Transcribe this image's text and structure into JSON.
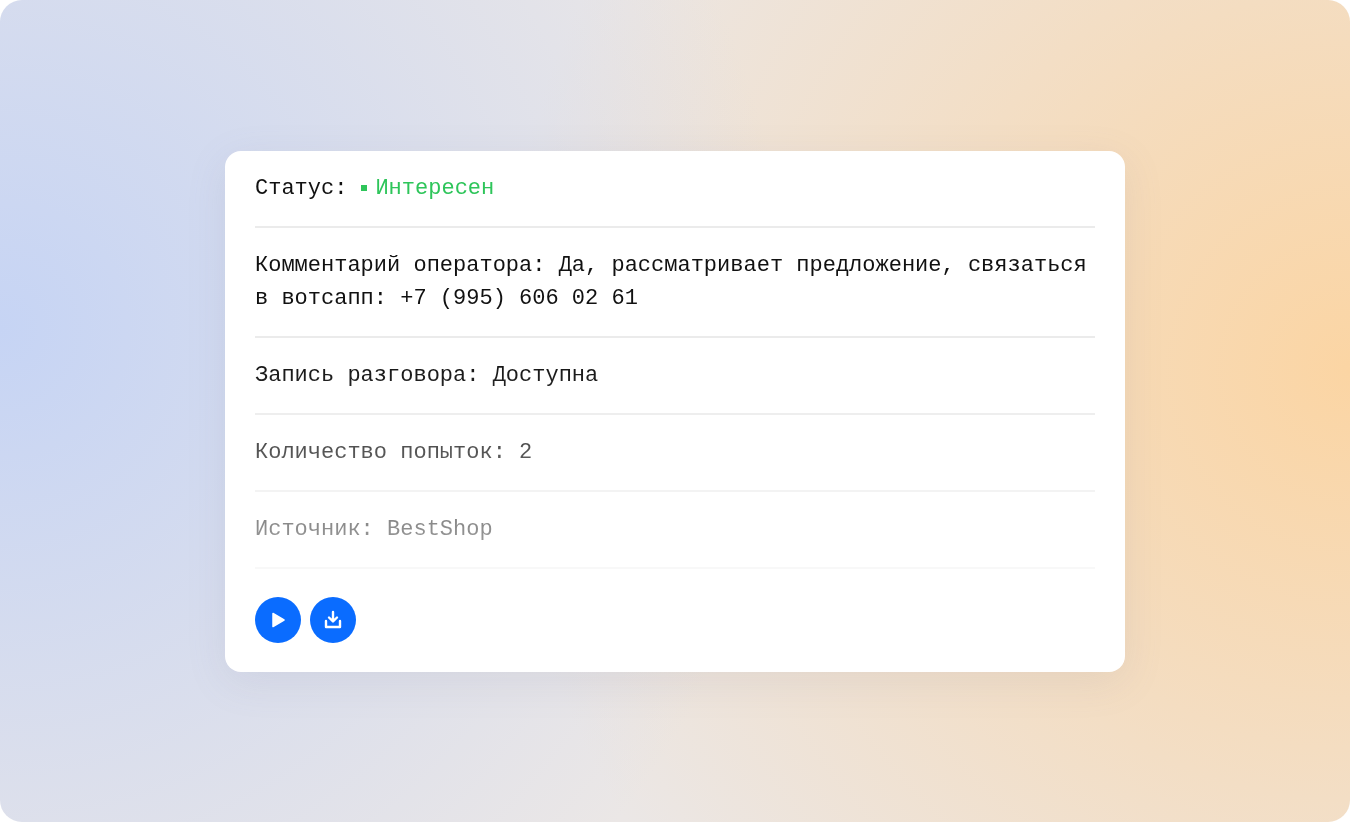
{
  "card": {
    "rows": [
      {
        "kind": "status",
        "label": "Статус:",
        "value": "Интересен",
        "color": "#2ec55a"
      },
      {
        "kind": "text",
        "text": "Комментарий оператора: Да, рассматривает предложение, связаться в вотсапп: +7 (995) 606 02 61"
      },
      {
        "kind": "text",
        "text": "Запись разговора: Доступна"
      },
      {
        "kind": "text",
        "text": "Количество попыток: 2"
      },
      {
        "kind": "text",
        "text": "Источник: BestShop"
      }
    ],
    "actions": [
      {
        "kind": "play"
      },
      {
        "kind": "download"
      }
    ]
  }
}
